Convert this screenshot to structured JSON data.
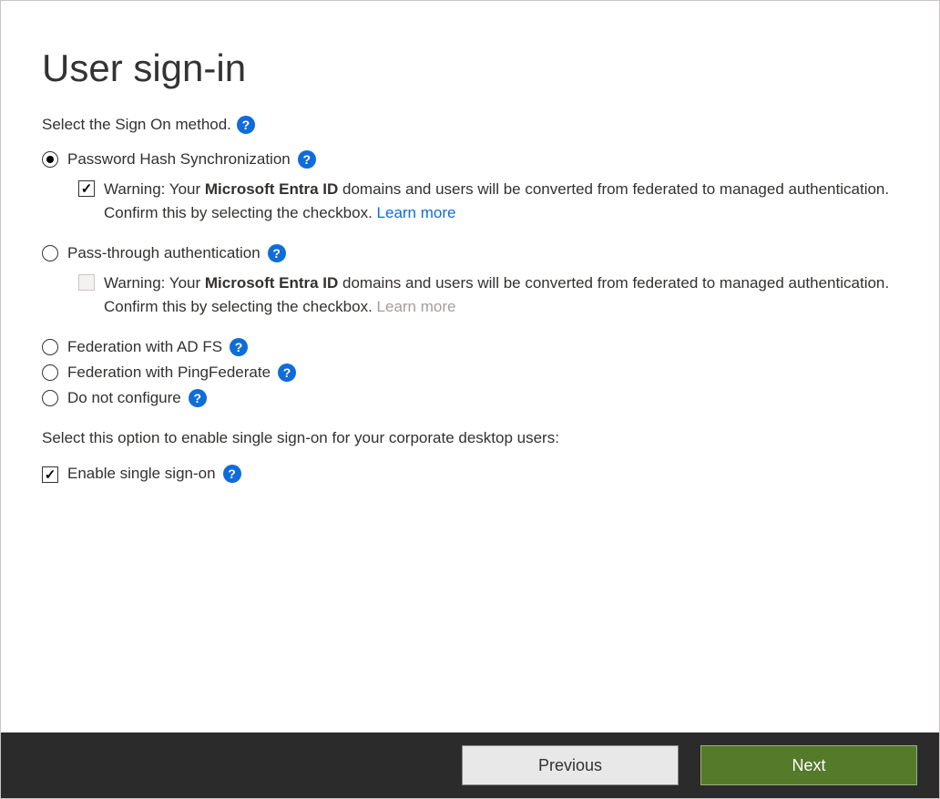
{
  "title": "User sign-in",
  "signOnLabel": "Select the Sign On method.",
  "options": {
    "phs": {
      "label": "Password Hash Synchronization",
      "selected": true
    },
    "pta": {
      "label": "Pass-through authentication",
      "selected": false
    },
    "adfs": {
      "label": "Federation with AD FS",
      "selected": false
    },
    "ping": {
      "label": "Federation with PingFederate",
      "selected": false
    },
    "none": {
      "label": "Do not configure",
      "selected": false
    }
  },
  "warning": {
    "prefix": "Warning: Your ",
    "bold": "Microsoft Entra ID",
    "suffix": " domains and users will be converted from federated to managed authentication. Confirm this by selecting the checkbox. ",
    "learnMore": "Learn more"
  },
  "sso": {
    "intro": "Select this option to enable single sign-on for your corporate desktop users:",
    "label": "Enable single sign-on",
    "checked": true
  },
  "buttons": {
    "previous": "Previous",
    "next": "Next"
  },
  "helpGlyph": "?"
}
